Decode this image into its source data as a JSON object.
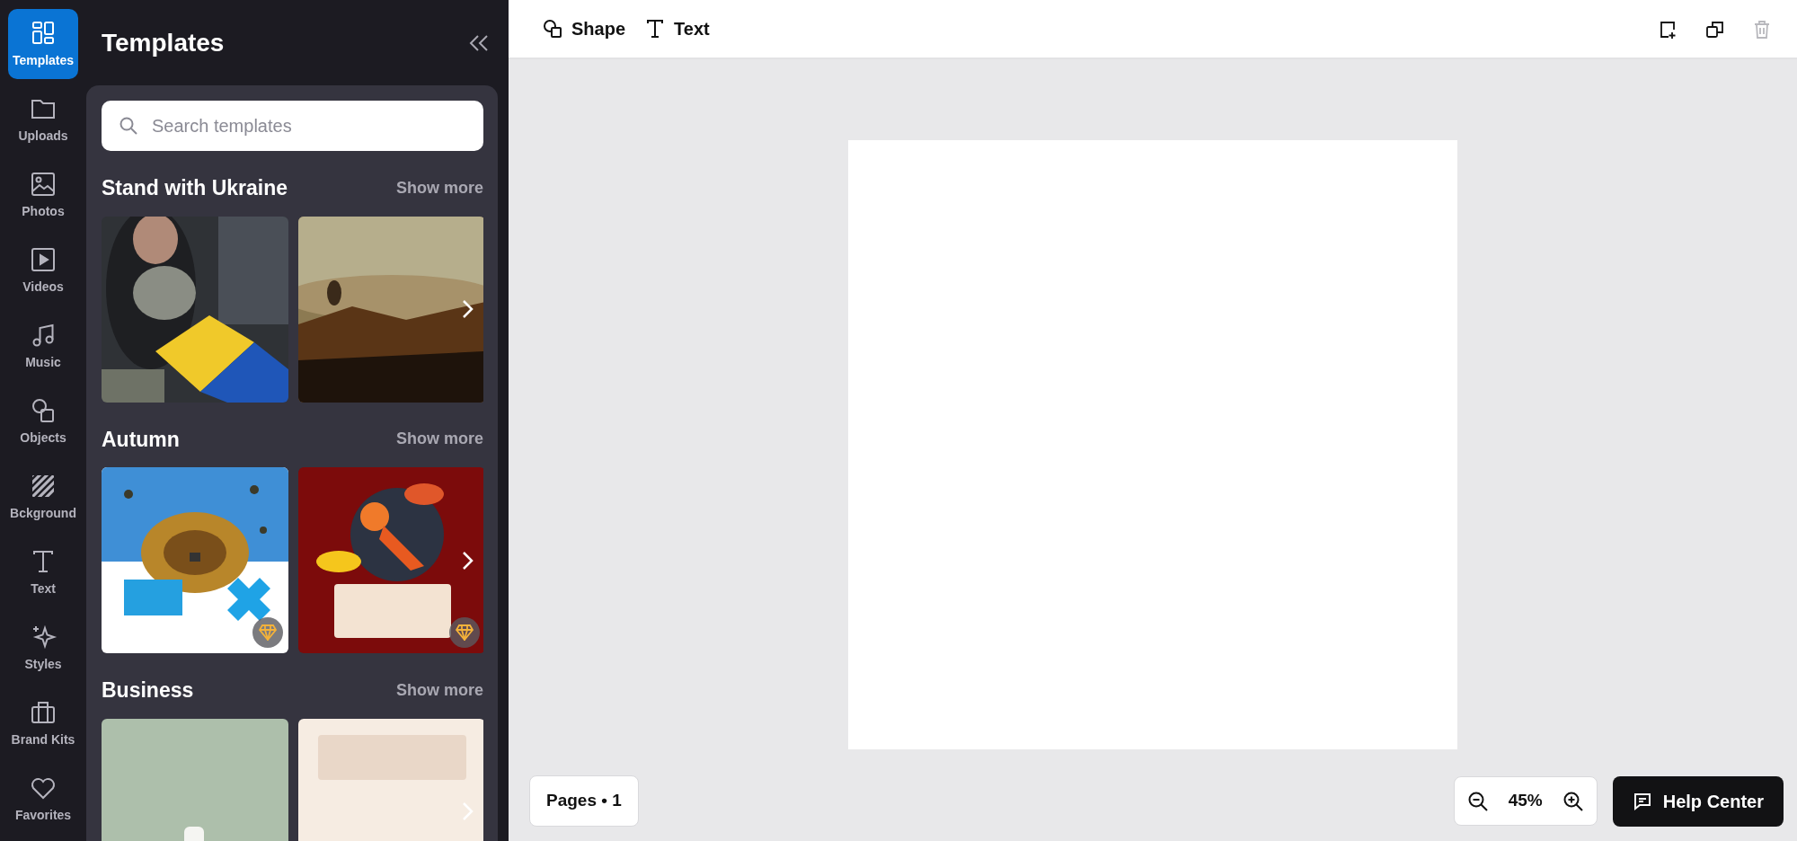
{
  "rail": [
    {
      "kind": "templates",
      "label": "Templates",
      "selected": true
    },
    {
      "kind": "uploads",
      "label": "Uploads",
      "selected": false
    },
    {
      "kind": "photos",
      "label": "Photos",
      "selected": false
    },
    {
      "kind": "videos",
      "label": "Videos",
      "selected": false
    },
    {
      "kind": "music",
      "label": "Music",
      "selected": false
    },
    {
      "kind": "objects",
      "label": "Objects",
      "selected": false
    },
    {
      "kind": "background",
      "label": "Bckground",
      "selected": false
    },
    {
      "kind": "text",
      "label": "Text",
      "selected": false
    },
    {
      "kind": "styles",
      "label": "Styles",
      "selected": false
    },
    {
      "kind": "brand",
      "label": "Brand Kits",
      "selected": false
    },
    {
      "kind": "favorites",
      "label": "Favorites",
      "selected": false
    }
  ],
  "panel": {
    "title": "Templates",
    "search": {
      "placeholder": "Search templates"
    },
    "sections": [
      {
        "title": "Stand with Ukraine",
        "show_more": "Show more",
        "templates": [
          {
            "kind": "picture",
            "premium": false
          },
          {
            "kind": "picture",
            "premium": false
          }
        ]
      },
      {
        "title": "Autumn",
        "show_more": "Show more",
        "templates": [
          {
            "kind": "picture",
            "premium": true
          },
          {
            "kind": "picture",
            "premium": true
          }
        ]
      },
      {
        "title": "Business",
        "show_more": "Show more",
        "templates": [
          {
            "kind": "picture"
          },
          {
            "kind": "picture"
          }
        ]
      }
    ]
  },
  "toolbar": {
    "tools": [
      {
        "kind": "shape",
        "label": "Shape"
      },
      {
        "kind": "text",
        "label": "Text"
      }
    ],
    "actions": [
      {
        "kind": "add-page",
        "disabled": false
      },
      {
        "kind": "duplicate",
        "disabled": false
      },
      {
        "kind": "delete",
        "disabled": true
      }
    ]
  },
  "footer": {
    "pages": "Pages • 1",
    "zoom": "45%",
    "help": "Help Center"
  }
}
